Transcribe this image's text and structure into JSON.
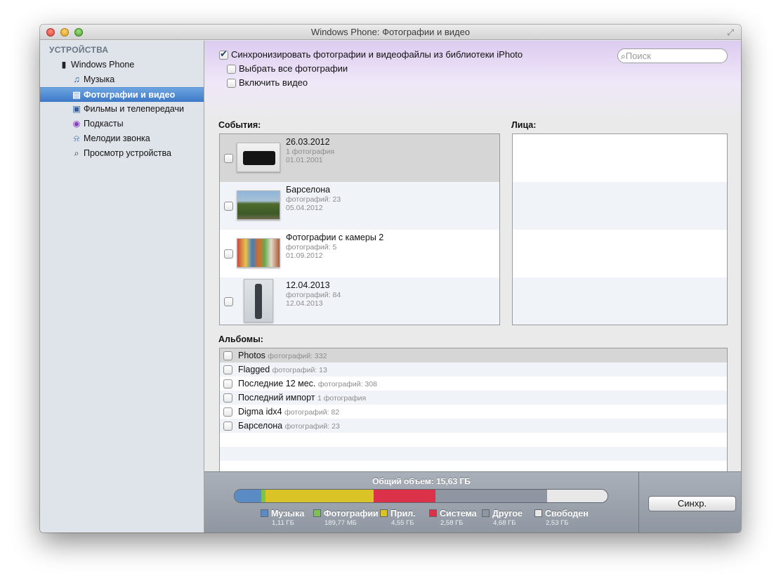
{
  "window": {
    "title": "Windows Phone: Фотографии и видео"
  },
  "sidebar": {
    "header": "УСТРОЙСТВА",
    "device": "Windows Phone",
    "items": [
      {
        "label": "Музыка",
        "icon": "music-note-icon"
      },
      {
        "label": "Фотографии и видео",
        "icon": "photos-icon"
      },
      {
        "label": "Фильмы и телепередачи",
        "icon": "tv-icon"
      },
      {
        "label": "Подкасты",
        "icon": "podcast-icon"
      },
      {
        "label": "Мелодии звонка",
        "icon": "bell-icon"
      },
      {
        "label": "Просмотр устройства",
        "icon": "magnifier-icon"
      }
    ]
  },
  "options": {
    "sync_iphoto": "Синхронизировать фотографии и видеофайлы из библиотеки iPhoto",
    "select_all": "Выбрать все фотографии",
    "include_video": "Включить видео"
  },
  "search": {
    "placeholder": "Поиск"
  },
  "events": {
    "label": "События:",
    "rows": [
      {
        "title": "26.03.2012",
        "count": "1 фотография",
        "date": "01.01.2001"
      },
      {
        "title": "Барселона",
        "count": "фотографий: 23",
        "date": "05.04.2012"
      },
      {
        "title": "Фотографии с камеры 2",
        "count": "фотографий: 5",
        "date": "01.09.2012"
      },
      {
        "title": "12.04.2013",
        "count": "фотографий: 84",
        "date": "12.04.2013"
      }
    ]
  },
  "faces": {
    "label": "Лица:"
  },
  "albums": {
    "label": "Альбомы:",
    "rows": [
      {
        "name": "Photos",
        "count": "фотографий: 332"
      },
      {
        "name": "Flagged",
        "count": "фотографий: 13"
      },
      {
        "name": "Последние 12 мес.",
        "count": "фотографий: 308"
      },
      {
        "name": "Последний импорт",
        "count": "1 фотография"
      },
      {
        "name": "Digma idx4",
        "count": "фотографий: 82"
      },
      {
        "name": "Барселона",
        "count": "фотографий: 23"
      }
    ]
  },
  "capacity": {
    "label": "Общий объем: 15,63 ГБ",
    "legend": [
      {
        "name": "Музыка",
        "value": "1,11 ГБ",
        "color": "#5b8bc5"
      },
      {
        "name": "Фотографии",
        "value": "189,77 МБ",
        "color": "#7cc24f"
      },
      {
        "name": "Прил.",
        "value": "4,55 ГБ",
        "color": "#d9c327"
      },
      {
        "name": "Система",
        "value": "2,58 ГБ",
        "color": "#dc3249"
      },
      {
        "name": "Другое",
        "value": "4,68 ГБ",
        "color": "#8f96a2"
      },
      {
        "name": "Свободен",
        "value": "2,53 ГБ",
        "color": "#e8e8e8"
      }
    ]
  },
  "sync_button": "Синхр."
}
